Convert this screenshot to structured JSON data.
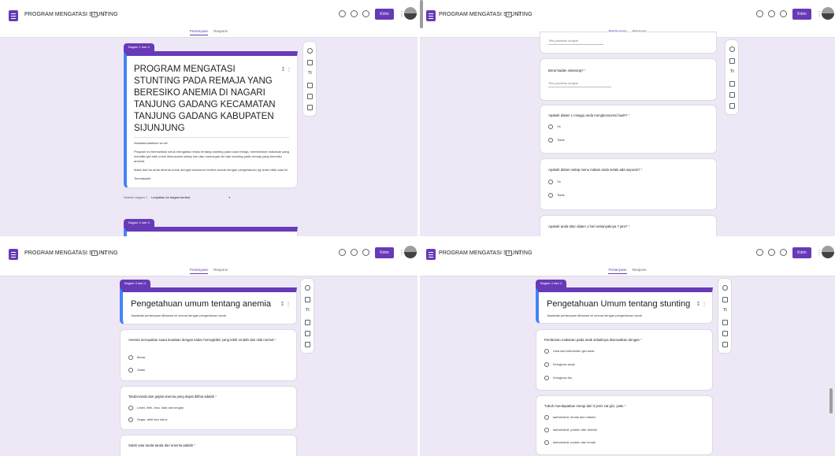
{
  "app": {
    "title": "PROGRAM MENGATASI STUNTING",
    "star": "☆",
    "send": "Kirim",
    "more": "⋮",
    "tabs": [
      "Pertanyaan",
      "Respons"
    ]
  },
  "toolbar_icons": [
    "add-question-icon",
    "import-icon",
    "add-title-icon",
    "add-image-icon",
    "add-video-icon",
    "add-section-icon"
  ],
  "panel1": {
    "section_label": "Bagian 1 dari 4",
    "form_title": "PROGRAM MENGATASI STUNTING PADA REMAJA YANG BERESIKO ANEMIA DI NAGARI TANJUNG GADANG KECAMATAN TANJUNG GADANG KABUPATEN SIJUNJUNG",
    "greeting": "Assalamualaikum wr.wb",
    "description": "Program ini bermanfaat untuk mengatasi resiko tentang stunting pada usia remaja, memberikan makanan yang memiliki gizi baik untuk dikonsumsi setiap hari dan mencegah diri dari stunting pada remaja yang beresiko anemia.",
    "instruction": "Maka dari itu anda diminta untuk mengisi kuesioner berikut sesuai dengan pengetahuan yg anda miliki saat ini",
    "thanks": "Terimakasih",
    "after_section_prefix": "Setelah bagian 1",
    "after_section_value": "Lanjutkan ke bagian berikut",
    "next_section_label": "Bagian 2 dari 4"
  },
  "panel2": {
    "top_placeholder": "Teks jawaban singkat",
    "q1": "Berat badan sekarang?",
    "q1_placeholder": "Teks jawaban singkat",
    "q2": "Apakah dalam 1 minggu anda mengkonsumsi buah?",
    "q2_options": [
      "Ya",
      "Tidak"
    ],
    "q3": "Apakah dalam setiap menu makan anda selalu ada sayuran?",
    "q3_options": [
      "Ya",
      "Tidak"
    ],
    "q4": "Apakah anda tidur dalam 1 hari sebanyaknya 7 jam?"
  },
  "panel3": {
    "section_label": "Bagian 3 dari 4",
    "title": "Pengetahuan umum tentang anemia",
    "subtitle": "Jawablah pertanyaan dibawah ini sesuai dengan pengetahuan anda",
    "q1": "Anemia merupakan suatu keadaan dengan kadar hemoglobin yang lebih rendah dari nilai normal",
    "q1_options": [
      "Benar",
      "Salah"
    ],
    "q2": "Tanda-tanda dan gejala anemia yang dapat dilihat adalah",
    "q2_options": [
      "Lelah, letih, lesu, lalai dan lunglai",
      "Segar, aktif dan fokus"
    ],
    "q3": "Salah satu tanda-tanda dari anemia adalah"
  },
  "panel4": {
    "section_label": "Bagian 4 dari 4",
    "title": "Pengetahuan Umum tentang stunting",
    "subtitle": "Jawablah pertanyaan dibawah ini sesuai dengan pengetahuan anda",
    "q1": "Pemberian makanan pada anak sebaiknya disesuaikan dengan",
    "q1_options": [
      "Usia dan kebutuhan gizi anak",
      "Keinginan anak",
      "Keinginan ibu"
    ],
    "q2": "Tubuh mendapatkan energi dari 3 jenis zat gizi, yaitu",
    "q2_options": [
      "karbohidrat, lemak dan vitamin",
      "karbohidrat, protein dan vitamin",
      "karbohidrat, protein dan lemak"
    ]
  },
  "colors": {
    "accent": "#673ab7",
    "background": "#ede7f6",
    "required": "#d93025"
  }
}
